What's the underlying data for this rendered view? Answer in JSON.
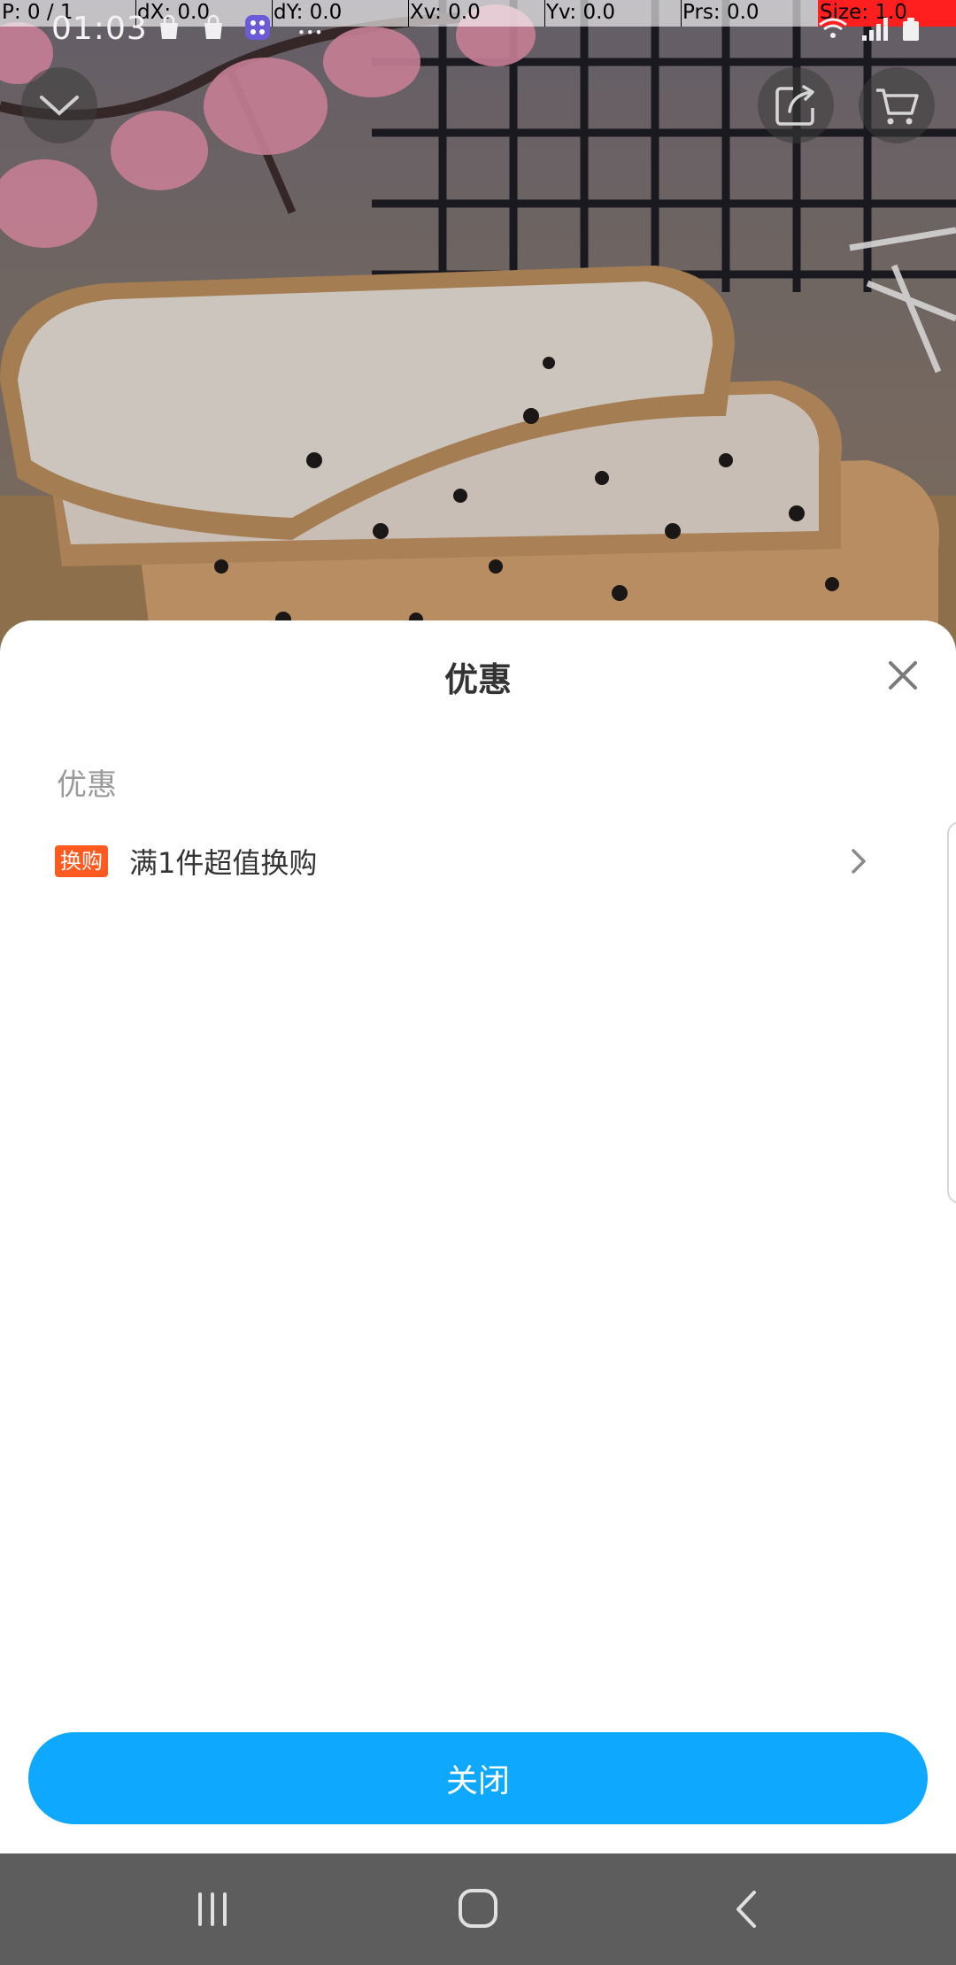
{
  "debug": {
    "p": "P: 0 / 1",
    "dx": "dX: 0.0",
    "dy": "dY: 0.0",
    "xv": "Xv: 0.0",
    "yv": "Yv: 0.0",
    "prs": "Prs: 0.0",
    "size": "Size: 1.0"
  },
  "status_bar": {
    "time": "01:03",
    "icons": [
      "shopping-bag-icon",
      "shopping-bag-icon",
      "app-grid-icon",
      "more-dots-icon",
      "wifi-icon",
      "signal-icon",
      "battery-icon"
    ]
  },
  "top_buttons": [
    "collapse-chevron-icon",
    "share-icon",
    "cart-icon"
  ],
  "sheet": {
    "title": "优惠",
    "section_label": "优惠",
    "promo": {
      "badge": "换购",
      "text": "满1件超值换购"
    },
    "close_button": "关闭"
  },
  "colors": {
    "accent": "#0fa8ff",
    "badge": "#ff5a1f",
    "title": "#333333",
    "label": "#9a9a9a"
  },
  "navbar": [
    "recent-apps-icon",
    "home-icon",
    "back-icon"
  ]
}
